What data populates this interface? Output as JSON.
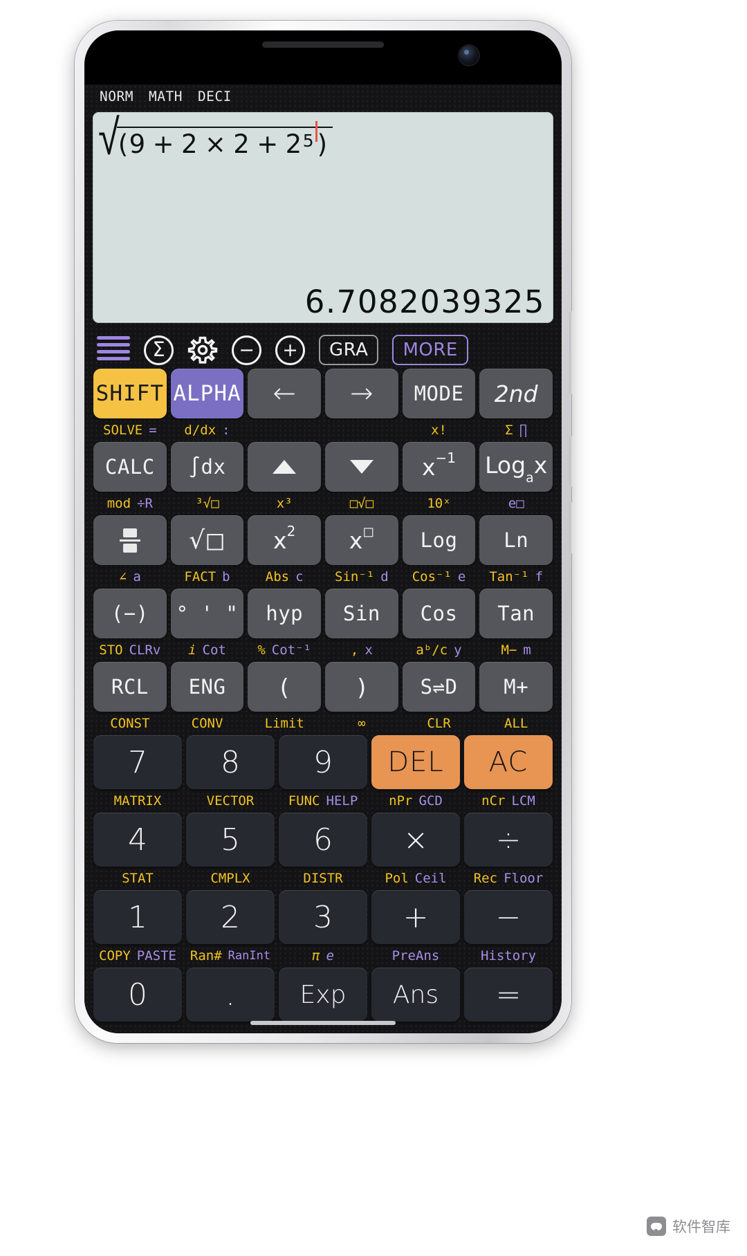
{
  "app": {
    "status_flags": [
      "NORM",
      "MATH",
      "DECI"
    ],
    "display": {
      "expression_prefix": "(9",
      "expression_full": "√((9+2×2+2^5))",
      "expr_tokens": [
        "(",
        "9",
        "+",
        "2",
        "×",
        "2",
        "+",
        "2"
      ],
      "expr_exponent": "5",
      "expr_closing": ")",
      "result": "6.7082039325",
      "bg_color": "#d5e0de",
      "cursor_color": "#e8544b"
    },
    "toolbar": [
      {
        "name": "menu-icon",
        "label": "☰",
        "kind": "lines",
        "color": "#9d86e0"
      },
      {
        "name": "sigma-icon",
        "label": "Σ",
        "kind": "circle",
        "color": "#f3f3f4"
      },
      {
        "name": "gear-icon",
        "label": "⚙",
        "kind": "gear",
        "color": "#f3f3f4"
      },
      {
        "name": "minus-circle-icon",
        "label": "−",
        "kind": "circle",
        "color": "#f3f3f4"
      },
      {
        "name": "plus-circle-icon",
        "label": "+",
        "kind": "circle",
        "color": "#f3f3f4"
      },
      {
        "name": "gra-button",
        "label": "GRA",
        "kind": "pill",
        "color": "#f0f0f1"
      },
      {
        "name": "more-button",
        "label": "MORE",
        "kind": "pill",
        "color": "#9d86e0"
      }
    ],
    "colors": {
      "shift_key": "#f5c243",
      "alpha_key": "#7b6fc4",
      "function_key": "#55565c",
      "number_key": "#262930",
      "action_key": "#e89453",
      "shift_hint": "#f2c321",
      "alpha_hint": "#a78fe8",
      "accent_purple": "#9d86e0"
    },
    "keypad_rows": [
      {
        "keys": [
          {
            "label": "SHIFT",
            "style": "shift"
          },
          {
            "label": "ALPHA",
            "style": "alpha"
          },
          {
            "label": "←",
            "style": "arrow"
          },
          {
            "label": "→",
            "style": "arrow"
          },
          {
            "label": "MODE",
            "style": "mono"
          },
          {
            "label": "2nd",
            "style": "ital"
          }
        ],
        "hints": [
          {
            "shift": "SOLVE",
            "alpha": "="
          },
          {
            "shift": "d/dx",
            "alpha": ":"
          },
          {
            "shift": "",
            "alpha": ""
          },
          {
            "shift": "",
            "alpha": ""
          },
          {
            "shift": "x!",
            "alpha": ""
          },
          {
            "shift": "Σ",
            "alpha": "∏"
          }
        ]
      },
      {
        "keys": [
          {
            "label": "CALC",
            "style": "mono"
          },
          {
            "label": "∫dx",
            "style": "mono"
          },
          {
            "label": "▲",
            "style": "tri-up"
          },
          {
            "label": "▼",
            "style": "tri-down"
          },
          {
            "label": "x⁻¹",
            "style": "pow-inv"
          },
          {
            "label": "Logₐx",
            "style": "logax"
          }
        ],
        "hints": [
          {
            "shift": "mod",
            "alpha": "÷R"
          },
          {
            "shift": "³√□",
            "alpha": ""
          },
          {
            "shift": "x³",
            "alpha": ""
          },
          {
            "shift": "□√□",
            "alpha": ""
          },
          {
            "shift": "10ˣ",
            "alpha": ""
          },
          {
            "shift": "e□",
            "alpha": ""
          }
        ]
      },
      {
        "keys": [
          {
            "label": "frac",
            "style": "frac"
          },
          {
            "label": "√□",
            "style": "sqrt"
          },
          {
            "label": "x²",
            "style": "pow2"
          },
          {
            "label": "x□",
            "style": "powbox"
          },
          {
            "label": "Log",
            "style": "mono"
          },
          {
            "label": "Ln",
            "style": "mono"
          }
        ],
        "hints": [
          {
            "shift": "∠",
            "alpha": "a"
          },
          {
            "shift": "FACT",
            "alpha": "b"
          },
          {
            "shift": "Abs",
            "alpha": "c"
          },
          {
            "shift": "Sin⁻¹",
            "alpha": "d"
          },
          {
            "shift": "Cos⁻¹",
            "alpha": "e"
          },
          {
            "shift": "Tan⁻¹",
            "alpha": "f"
          }
        ]
      },
      {
        "keys": [
          {
            "label": "(−)",
            "style": "mono"
          },
          {
            "label": "° ' \"",
            "style": "mono"
          },
          {
            "label": "hyp",
            "style": "mono"
          },
          {
            "label": "Sin",
            "style": "mono"
          },
          {
            "label": "Cos",
            "style": "mono"
          },
          {
            "label": "Tan",
            "style": "mono"
          }
        ],
        "hints": [
          {
            "shift": "STO",
            "alpha": "CLRv"
          },
          {
            "shift": "i",
            "alpha": "Cot"
          },
          {
            "shift": "%",
            "alpha": "Cot⁻¹"
          },
          {
            "shift": ",",
            "alpha": "x"
          },
          {
            "shift": "aᵇ/c",
            "alpha": "y"
          },
          {
            "shift": "M−",
            "alpha": "m"
          }
        ]
      },
      {
        "keys": [
          {
            "label": "RCL",
            "style": "mono"
          },
          {
            "label": "ENG",
            "style": "mono"
          },
          {
            "label": "(",
            "style": "plain"
          },
          {
            "label": ")",
            "style": "plain"
          },
          {
            "label": "S⇌D",
            "style": "mono"
          },
          {
            "label": "M+",
            "style": "mono"
          }
        ],
        "hints": [
          {
            "shift": "CONST",
            "alpha": ""
          },
          {
            "shift": "CONV",
            "alpha": ""
          },
          {
            "shift": "Limit",
            "alpha": ""
          },
          {
            "shift": "∞",
            "alpha": ""
          },
          {
            "shift": "CLR",
            "alpha": ""
          },
          {
            "shift": "ALL",
            "alpha": ""
          }
        ]
      },
      {
        "keys": [
          {
            "label": "7",
            "style": "num"
          },
          {
            "label": "8",
            "style": "num"
          },
          {
            "label": "9",
            "style": "num"
          },
          {
            "label": "DEL",
            "style": "orange"
          },
          {
            "label": "AC",
            "style": "orange"
          }
        ],
        "hints": [
          {
            "shift": "MATRIX",
            "alpha": ""
          },
          {
            "shift": "VECTOR",
            "alpha": ""
          },
          {
            "shift": "FUNC",
            "alpha": "HELP"
          },
          {
            "shift": "nPr",
            "alpha": "GCD"
          },
          {
            "shift": "nCr",
            "alpha": "LCM"
          }
        ]
      },
      {
        "keys": [
          {
            "label": "4",
            "style": "num"
          },
          {
            "label": "5",
            "style": "num"
          },
          {
            "label": "6",
            "style": "num"
          },
          {
            "label": "×",
            "style": "num"
          },
          {
            "label": "÷",
            "style": "num"
          }
        ],
        "hints": [
          {
            "shift": "STAT",
            "alpha": ""
          },
          {
            "shift": "CMPLX",
            "alpha": ""
          },
          {
            "shift": "DISTR",
            "alpha": ""
          },
          {
            "shift": "Pol",
            "alpha": "Ceil"
          },
          {
            "shift": "Rec",
            "alpha": "Floor"
          }
        ]
      },
      {
        "keys": [
          {
            "label": "1",
            "style": "num"
          },
          {
            "label": "2",
            "style": "num"
          },
          {
            "label": "3",
            "style": "num"
          },
          {
            "label": "+",
            "style": "num"
          },
          {
            "label": "−",
            "style": "num"
          }
        ],
        "hints": [
          {
            "shift": "COPY",
            "alpha": "PASTE"
          },
          {
            "shift": "Ran#",
            "alpha": "RanInt"
          },
          {
            "shift": "π",
            "alpha": "e"
          },
          {
            "shift": "PreAns",
            "alpha": ""
          },
          {
            "shift": "History",
            "alpha": ""
          }
        ]
      },
      {
        "keys": [
          {
            "label": "0",
            "style": "num"
          },
          {
            "label": ".",
            "style": "num"
          },
          {
            "label": "Exp",
            "style": "num-txt"
          },
          {
            "label": "Ans",
            "style": "num-txt"
          },
          {
            "label": "=",
            "style": "num"
          }
        ],
        "hints": []
      }
    ],
    "watermark": "软件智库"
  }
}
